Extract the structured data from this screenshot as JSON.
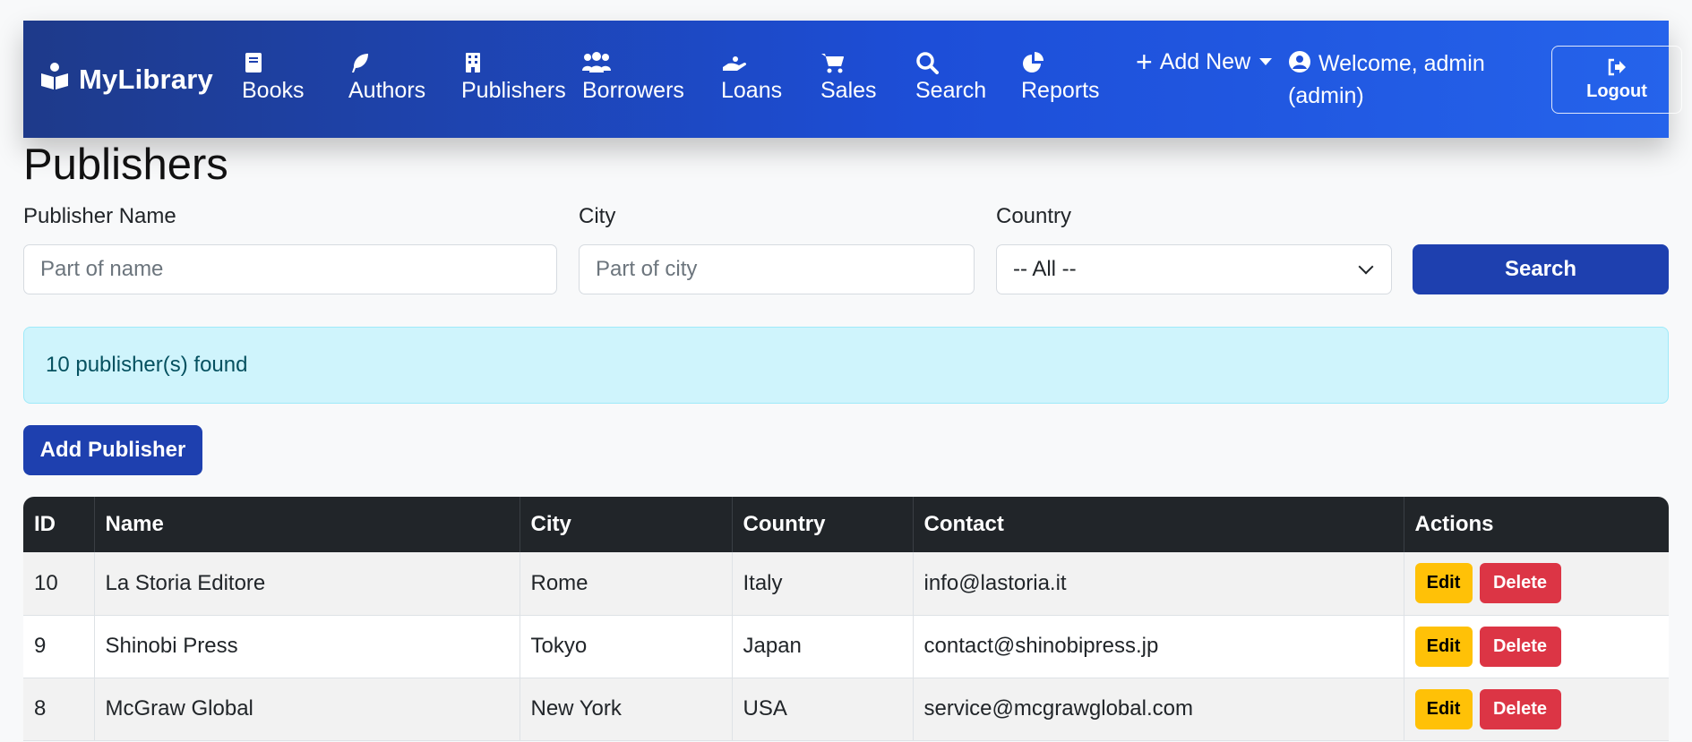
{
  "brand": {
    "name": "MyLibrary",
    "icon": "book-open-reader-icon"
  },
  "nav": [
    {
      "label": "Books",
      "icon": "book-icon"
    },
    {
      "label": "Authors",
      "icon": "feather-icon"
    },
    {
      "label": "Publishers",
      "icon": "building-icon"
    },
    {
      "label": "Borrowers",
      "icon": "users-icon"
    },
    {
      "label": "Loans",
      "icon": "hand-holding-icon"
    },
    {
      "label": "Sales",
      "icon": "cart-icon"
    },
    {
      "label": "Search",
      "icon": "search-icon"
    },
    {
      "label": "Reports",
      "icon": "pie-chart-icon"
    }
  ],
  "add_new": {
    "label": "Add New"
  },
  "user": {
    "welcome": "Welcome, admin (admin)"
  },
  "logout": {
    "label": "Logout"
  },
  "page": {
    "title": "Publishers"
  },
  "filters": {
    "name_label": "Publisher Name",
    "name_placeholder": "Part of name",
    "city_label": "City",
    "city_placeholder": "Part of city",
    "country_label": "Country",
    "country_selected": "-- All --",
    "search_button": "Search"
  },
  "result": {
    "message": "10 publisher(s) found"
  },
  "add_publisher": {
    "label": "Add Publisher"
  },
  "table": {
    "headers": [
      "ID",
      "Name",
      "City",
      "Country",
      "Contact",
      "Actions"
    ],
    "rows": [
      {
        "id": "10",
        "name": "La Storia Editore",
        "city": "Rome",
        "country": "Italy",
        "contact": "info@lastoria.it",
        "edit": "Edit",
        "delete": "Delete"
      },
      {
        "id": "9",
        "name": "Shinobi Press",
        "city": "Tokyo",
        "country": "Japan",
        "contact": "contact@shinobipress.jp",
        "edit": "Edit",
        "delete": "Delete"
      },
      {
        "id": "8",
        "name": "McGraw Global",
        "city": "New York",
        "country": "USA",
        "contact": "service@mcgrawglobal.com",
        "edit": "Edit",
        "delete": "Delete"
      }
    ]
  },
  "colors": {
    "navbar": "#1d4ed8",
    "primary": "#1e40af",
    "edit": "#ffc107",
    "delete": "#dc3545",
    "alert_bg": "#cff4fc",
    "table_header": "#212529"
  }
}
